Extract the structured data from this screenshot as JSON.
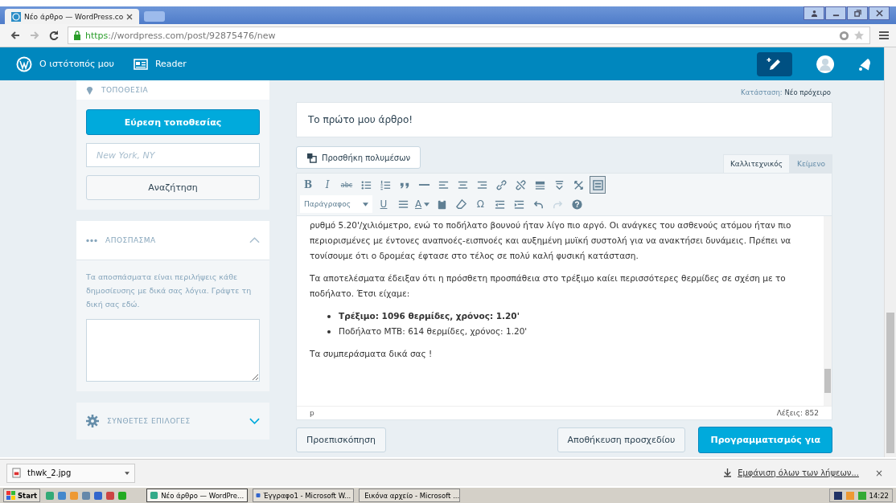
{
  "browser": {
    "tab_title": "Νέο άρθρο — WordPress.co",
    "url_scheme": "https",
    "url_rest": "://wordpress.com/post/92875476/new"
  },
  "masthead": {
    "items": [
      {
        "kind": "site",
        "label": "Ο ιστότοπός μου"
      },
      {
        "kind": "reader",
        "label": "Reader"
      }
    ]
  },
  "sidebar": {
    "location": {
      "heading": "ΤΟΠΟΘΕΣΙΑ",
      "find_button": "Εύρεση τοποθεσίας",
      "search": {
        "placeholder": "New York, NY"
      },
      "search_button": "Αναζήτηση"
    },
    "excerpt": {
      "heading": "ΑΠΟΣΠΑΣΜΑ",
      "expanded": true,
      "description": "Τα αποσπάσματα είναι περιλήψεις κάθε δημοσίευσης με δικά σας λόγια. Γράψτε τη δική σας εδώ."
    },
    "advanced": {
      "heading": "ΣΥΝΘΕΤΕΣ ΕΠΙΛΟΓΕΣ",
      "expanded": false
    }
  },
  "editor": {
    "status_label": "Κατάσταση:",
    "status_value": "Νέο πρόχειρο",
    "title": "Το πρώτο μου άρθρο!",
    "add_media": "Προσθήκη πολυμέσων",
    "tabs": [
      {
        "label": "Καλλιτεχνικός",
        "selected": true
      },
      {
        "label": "Κείμενο",
        "selected": false
      }
    ],
    "toolbar_rows": [
      [
        {
          "kind": "bold",
          "glyph": "B",
          "pressed": false,
          "disabled": false
        },
        {
          "kind": "italic",
          "glyph": "I",
          "pressed": false,
          "disabled": false
        },
        {
          "kind": "strike",
          "glyph": "abc",
          "pressed": false,
          "disabled": false
        },
        {
          "kind": "bullets",
          "pressed": false,
          "disabled": false
        },
        {
          "kind": "numbers",
          "pressed": false,
          "disabled": false
        },
        {
          "kind": "quote",
          "pressed": false,
          "disabled": false
        },
        {
          "kind": "rule",
          "pressed": false,
          "disabled": false
        },
        {
          "kind": "align-left",
          "pressed": false,
          "disabled": false
        },
        {
          "kind": "align-center",
          "pressed": false,
          "disabled": false
        },
        {
          "kind": "align-right",
          "pressed": false,
          "disabled": false
        },
        {
          "kind": "link",
          "pressed": false,
          "disabled": false
        },
        {
          "kind": "unlink",
          "pressed": false,
          "disabled": false
        },
        {
          "kind": "more",
          "pressed": false,
          "disabled": false
        },
        {
          "kind": "spell",
          "pressed": false,
          "disabled": false
        },
        {
          "kind": "fullscreen",
          "pressed": false,
          "disabled": false
        },
        {
          "kind": "kitchen",
          "pressed": true,
          "disabled": false
        }
      ],
      [
        {
          "kind": "format",
          "glyph": "Παράγραφος",
          "pressed": false,
          "disabled": false
        },
        {
          "kind": "underline",
          "glyph": "U",
          "pressed": false,
          "disabled": false
        },
        {
          "kind": "justify",
          "pressed": false,
          "disabled": false
        },
        {
          "kind": "color",
          "glyph": "A",
          "pressed": false,
          "disabled": false
        },
        {
          "kind": "paste",
          "pressed": false,
          "disabled": false
        },
        {
          "kind": "eraser",
          "pressed": false,
          "disabled": false
        },
        {
          "kind": "char",
          "glyph": "Ω",
          "pressed": false,
          "disabled": false
        },
        {
          "kind": "outdent",
          "pressed": false,
          "disabled": false
        },
        {
          "kind": "indent",
          "pressed": false,
          "disabled": false
        },
        {
          "kind": "undo",
          "pressed": false,
          "disabled": false
        },
        {
          "kind": "redo",
          "pressed": false,
          "disabled": true
        },
        {
          "kind": "help",
          "pressed": false,
          "disabled": false
        }
      ]
    ],
    "body": [
      {
        "kind": "paragraph",
        "text": "ρυθμό 5.20'/χιλιόμετρο, ενώ το ποδήλατο βουνού ήταν λίγο πιο αργό. Οι ανάγκες του ασθενούς ατόμου ήταν πιο περιορισμένες με έντονες αναπνοές-εισπνοές και αυξημένη μυϊκή συστολή για να ανακτήσει δυνάμεις. Πρέπει να τονίσουμε ότι ο δρομέας έφτασε στο τέλος σε πολύ καλή φυσική κατάσταση."
      },
      {
        "kind": "paragraph",
        "text": "Τα αποτελέσματα έδειξαν ότι η πρόσθετη προσπάθεια στο τρέξιμο καίει περισσότερες θερμίδες σε σχέση με το ποδήλατο. Έτσι είχαμε:"
      },
      {
        "kind": "list",
        "items": [
          {
            "text": "Τρέξιμο: 1096 θερμίδες, χρόνος: 1.20'",
            "bold": true
          },
          {
            "text": "Ποδήλατο MTB: 614 θερμίδες, χρόνος: 1.20'",
            "bold": false
          }
        ]
      },
      {
        "kind": "paragraph",
        "text": "Τα συμπεράσματα δικά σας !"
      }
    ],
    "path": "p",
    "word_count": "Λέξεις: 852",
    "preview": "Προεπισκόπηση",
    "save_draft": "Αποθήκευση προσχεδίου",
    "publish": "Προγραμματισμός για"
  },
  "download_bar": {
    "file": "thwk_2.jpg",
    "show_all": "Εμφάνιση όλων των λήψεων...",
    "close": "×"
  },
  "taskbar": {
    "start": "Start",
    "tasks": [
      {
        "label": "Νέο άρθρο — WordPre...",
        "selected": true
      },
      {
        "label": "Έγγραφο1 - Microsoft W...",
        "selected": false
      },
      {
        "label": "Εικόνα αρχείο - Microsoft ...",
        "selected": false
      }
    ],
    "clock": "14:22"
  }
}
